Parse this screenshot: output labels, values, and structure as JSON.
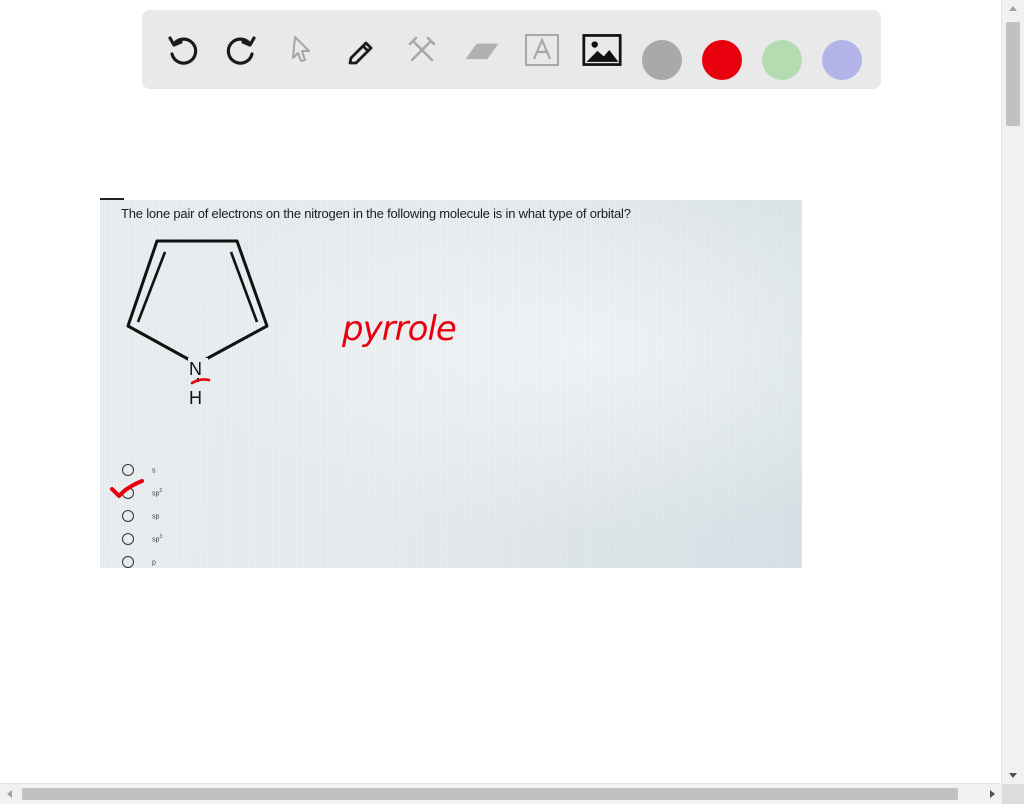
{
  "toolbar": {
    "tools": [
      {
        "name": "undo-icon"
      },
      {
        "name": "redo-icon"
      },
      {
        "name": "pointer-icon"
      },
      {
        "name": "pen-icon"
      },
      {
        "name": "tools-icon"
      },
      {
        "name": "eraser-icon"
      },
      {
        "name": "text-icon"
      },
      {
        "name": "image-icon"
      }
    ],
    "colors": [
      "#a9a9a9",
      "#e8000f",
      "#b5dbb0",
      "#b3b4e9"
    ]
  },
  "question": {
    "text": "The lone pair of electrons on the nitrogen in the following molecule is in what type of orbital?",
    "atom_n": "N",
    "atom_h": "H",
    "handwritten": "pyrrole"
  },
  "options": [
    {
      "base": "s",
      "sup": ""
    },
    {
      "base": "sp",
      "sup": "2"
    },
    {
      "base": "sp",
      "sup": ""
    },
    {
      "base": "sp",
      "sup": "3"
    },
    {
      "base": "p",
      "sup": ""
    }
  ]
}
